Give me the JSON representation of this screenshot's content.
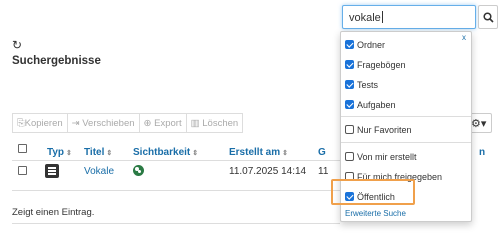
{
  "search": {
    "value": "vokale"
  },
  "page": {
    "title": "Suchergebnisse"
  },
  "toolbar": {
    "buttons": [
      {
        "icon": "copy-icon",
        "label": "Kopieren"
      },
      {
        "icon": "move-icon",
        "label": "Verschieben"
      },
      {
        "icon": "export-icon",
        "label": "Export"
      },
      {
        "icon": "trash-icon",
        "label": "Löschen"
      }
    ]
  },
  "table": {
    "headers": {
      "typ": "Typ",
      "titel": "Titel",
      "sichtbarkeit": "Sichtbarkeit",
      "erstellt": "Erstellt am",
      "g": "G",
      "n": "n"
    },
    "rows": [
      {
        "titel": "Vokale",
        "erstellt": "11.07.2025 14:14",
        "g": "11"
      }
    ],
    "footer": "Zeigt einen Eintrag."
  },
  "filter": {
    "close": "x",
    "types": [
      {
        "label": "Ordner",
        "checked": true
      },
      {
        "label": "Fragebögen",
        "checked": true
      },
      {
        "label": "Tests",
        "checked": true
      },
      {
        "label": "Aufgaben",
        "checked": true
      }
    ],
    "favorites": {
      "label": "Nur Favoriten",
      "checked": false
    },
    "ownership": [
      {
        "label": "Von mir erstellt",
        "checked": false
      },
      {
        "label": "Für mich freigegeben",
        "checked": false
      },
      {
        "label": "Öffentlich",
        "checked": true
      }
    ],
    "advanced": "Erweiterte Suche"
  },
  "colors": {
    "accent": "#1a73d9",
    "link": "#1a6ea8",
    "highlight": "#f0a04b"
  }
}
